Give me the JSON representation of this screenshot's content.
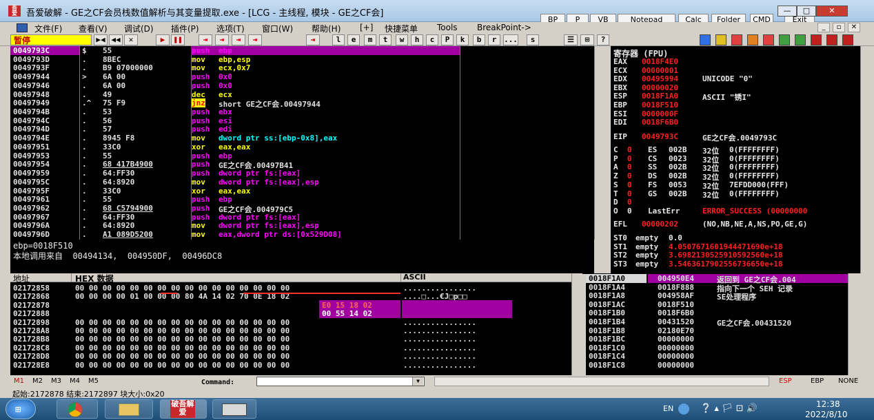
{
  "window": {
    "title": "吾爱破解 - GE之CF会员栈数值解析与其变量提取.exe - [LCG - 主线程, 模块 - GE之CF会]",
    "icon_text": "吾爱破解",
    "minimize": "—",
    "restore": "□",
    "close": "✕",
    "overlay_buttons": [
      "BP",
      "P",
      "VB",
      "Notepad",
      "Calc",
      "Folder",
      "CMD",
      "Exit"
    ]
  },
  "menu": {
    "items": [
      "文件(F)",
      "查看(V)",
      "调试(D)",
      "插件(P)",
      "选项(T)",
      "窗口(W)",
      "帮助(H)",
      "[+]",
      "快捷菜单",
      "Tools",
      "BreakPoint->"
    ],
    "mdi_controls": [
      "_",
      "▫",
      "✕"
    ]
  },
  "toolbar": {
    "status": "暂停",
    "nav_buttons": [
      "▶◀",
      "◀◀",
      "✕",
      "▶",
      "❚❚",
      "⇥",
      "⇥",
      "⇥",
      "⇥",
      "⇥",
      "l",
      "e",
      "m",
      "t",
      "w",
      "h",
      "c",
      "P",
      "k",
      "b",
      "r",
      "...",
      "s",
      "☰",
      "⊞",
      "?"
    ],
    "colors": [
      "#3070e0",
      "#e0c020",
      "#e04040",
      "#e08020",
      "#e04040",
      "#40a040",
      "#40a040",
      "#c02020",
      "#c02020",
      "#c02020"
    ]
  },
  "cpu": {
    "selected_addr": "0049793C",
    "rows": [
      {
        "addr": "0049793C",
        "flag": "$",
        "hex": "55",
        "op": "push",
        "arg": "ebp",
        "opc": "m",
        "argc": "m",
        "sel": true
      },
      {
        "addr": "0049793D",
        "flag": ".",
        "hex": "8BEC",
        "op": "mov",
        "arg": "ebp,esp",
        "opc": "y",
        "argc": "y"
      },
      {
        "addr": "0049793F",
        "flag": ".",
        "hex": "B9 07000000",
        "op": "mov",
        "arg": "ecx,0x7",
        "opc": "y",
        "argc": "y",
        "argnum": "0x7"
      },
      {
        "addr": "00497944",
        "flag": ">",
        "hex": "6A 00",
        "op": "push",
        "arg": "0x0",
        "opc": "m",
        "argc": "m"
      },
      {
        "addr": "00497946",
        "flag": ".",
        "hex": "6A 00",
        "op": "push",
        "arg": "0x0",
        "opc": "m",
        "argc": "m"
      },
      {
        "addr": "00497948",
        "flag": ".",
        "hex": "49",
        "op": "dec",
        "arg": "ecx",
        "opc": "y",
        "argc": "y"
      },
      {
        "addr": "00497949",
        "flag": ".^",
        "hex": "75 F9",
        "op": "jnz",
        "arg": "short GE之CF会.00497944",
        "opc": "jnz",
        "argc": "w"
      },
      {
        "addr": "0049794B",
        "flag": ".",
        "hex": "53",
        "op": "push",
        "arg": "ebx",
        "opc": "m",
        "argc": "m"
      },
      {
        "addr": "0049794C",
        "flag": ".",
        "hex": "56",
        "op": "push",
        "arg": "esi",
        "opc": "m",
        "argc": "m"
      },
      {
        "addr": "0049794D",
        "flag": ".",
        "hex": "57",
        "op": "push",
        "arg": "edi",
        "opc": "m",
        "argc": "m"
      },
      {
        "addr": "0049794E",
        "flag": ".",
        "hex": "8945 F8",
        "op": "mov",
        "arg": "dword ptr ss:[ebp-0x8],eax",
        "opc": "y",
        "argc": "c"
      },
      {
        "addr": "00497951",
        "flag": ".",
        "hex": "33C0",
        "op": "xor",
        "arg": "eax,eax",
        "opc": "y",
        "argc": "y"
      },
      {
        "addr": "00497953",
        "flag": ".",
        "hex": "55",
        "op": "push",
        "arg": "ebp",
        "opc": "m",
        "argc": "m"
      },
      {
        "addr": "00497954",
        "flag": ".",
        "hex": "68 417B4900",
        "op": "push",
        "arg": "GE之CF会.00497B41",
        "opc": "m",
        "argc": "w",
        "ul": true
      },
      {
        "addr": "00497959",
        "flag": ".",
        "hex": "64:FF30",
        "op": "push",
        "arg": "dword ptr fs:[eax]",
        "opc": "m",
        "argc": "m"
      },
      {
        "addr": "0049795C",
        "flag": ".",
        "hex": "64:8920",
        "op": "mov",
        "arg": "dword ptr fs:[eax],esp",
        "opc": "y",
        "argc": "m"
      },
      {
        "addr": "0049795F",
        "flag": ".",
        "hex": "33C0",
        "op": "xor",
        "arg": "eax,eax",
        "opc": "y",
        "argc": "y"
      },
      {
        "addr": "00497961",
        "flag": ".",
        "hex": "55",
        "op": "push",
        "arg": "ebp",
        "opc": "m",
        "argc": "m"
      },
      {
        "addr": "00497962",
        "flag": ".",
        "hex": "68 C5794900",
        "op": "push",
        "arg": "GE之CF会.004979C5",
        "opc": "m",
        "argc": "w",
        "ul": true
      },
      {
        "addr": "00497967",
        "flag": ".",
        "hex": "64:FF30",
        "op": "push",
        "arg": "dword ptr fs:[eax]",
        "opc": "m",
        "argc": "m"
      },
      {
        "addr": "0049796A",
        "flag": ".",
        "hex": "64:8920",
        "op": "mov",
        "arg": "dword ptr fs:[eax],esp",
        "opc": "y",
        "argc": "m"
      },
      {
        "addr": "0049796D",
        "flag": ".",
        "hex": "A1 089D5200",
        "op": "mov",
        "arg": "eax,dword ptr ds:[0x529D08]",
        "opc": "y",
        "argc": "m",
        "ul": true
      }
    ]
  },
  "info": {
    "line1": "ebp=0018F510",
    "line2": "本地调用来自  00494134,  004950DF,  00496DC8"
  },
  "registers": {
    "header": "寄存器 (FPU)",
    "gp": [
      {
        "name": "EAX",
        "val": "0018F4E0",
        "extra": ""
      },
      {
        "name": "ECX",
        "val": "00000001",
        "extra": ""
      },
      {
        "name": "EDX",
        "val": "00495994",
        "extra": "UNICODE \"0\""
      },
      {
        "name": "EBX",
        "val": "00000020",
        "extra": ""
      },
      {
        "name": "ESP",
        "val": "0018F1A0",
        "extra": "ASCII \"锈I\""
      },
      {
        "name": "EBP",
        "val": "0018F510",
        "extra": ""
      },
      {
        "name": "ESI",
        "val": "0000000F",
        "extra": ""
      },
      {
        "name": "EDI",
        "val": "0018F6B0",
        "extra": ""
      }
    ],
    "eip": {
      "name": "EIP",
      "val": "0049793C",
      "extra": "GE之CF会.0049793C"
    },
    "flags": [
      {
        "f": "C",
        "v": "0",
        "seg": "ES",
        "sv": "002B",
        "bits": "32位",
        "range": "0(FFFFFFFF)"
      },
      {
        "f": "P",
        "v": "0",
        "seg": "CS",
        "sv": "0023",
        "bits": "32位",
        "range": "0(FFFFFFFF)"
      },
      {
        "f": "A",
        "v": "0",
        "seg": "SS",
        "sv": "002B",
        "bits": "32位",
        "range": "0(FFFFFFFF)"
      },
      {
        "f": "Z",
        "v": "0",
        "seg": "DS",
        "sv": "002B",
        "bits": "32位",
        "range": "0(FFFFFFFF)"
      },
      {
        "f": "S",
        "v": "0",
        "seg": "FS",
        "sv": "0053",
        "bits": "32位",
        "range": "7EFDD000(FFF)"
      },
      {
        "f": "T",
        "v": "0",
        "seg": "GS",
        "sv": "002B",
        "bits": "32位",
        "range": "0(FFFFFFFF)"
      },
      {
        "f": "D",
        "v": "0",
        "seg": "",
        "sv": "",
        "bits": "",
        "range": ""
      }
    ],
    "lasterr": {
      "f": "O",
      "v": "0",
      "label": "LastErr",
      "val": "ERROR_SUCCESS (00000000"
    },
    "efl": {
      "name": "EFL",
      "val": "00000202",
      "extra": "(NO,NB,NE,A,NS,PO,GE,G)"
    },
    "fpu": [
      {
        "name": "ST0",
        "state": "empty",
        "val": "0.0",
        "red": false
      },
      {
        "name": "ST1",
        "state": "empty",
        "val": "4.0507671601944471690e+18",
        "red": true
      },
      {
        "name": "ST2",
        "state": "empty",
        "val": "3.6982130525910592560e+18",
        "red": true
      },
      {
        "name": "ST3",
        "state": "empty",
        "val": "3.5463617902556736650e+18",
        "red": true
      }
    ]
  },
  "dump": {
    "header_addr": "地址",
    "header_hex": "HEX 数据",
    "header_ascii": "ASCII",
    "rows": [
      {
        "addr": "02172858",
        "hex": "00 00 00 00 00 00 00 00 00 00 00 00 00 00 00 00",
        "ascii": "................"
      },
      {
        "addr": "02172868",
        "hex": "00 00 00 00 01 00 00 00 80 4A 14 02 70 0E 18 02",
        "ascii": "....□...€J□p□□"
      },
      {
        "addr": "02172878",
        "hex": "",
        "ascii": ""
      },
      {
        "addr": "02172888",
        "hex": "00 55 14 02",
        "ascii": ""
      },
      {
        "addr": "02172898",
        "hex": "00 00 00 00 00 00 00 00 00 00 00 00 00 00 00 00",
        "ascii": "................"
      },
      {
        "addr": "021728A8",
        "hex": "00 00 00 00 00 00 00 00 00 00 00 00 00 00 00 00",
        "ascii": "................"
      },
      {
        "addr": "021728B8",
        "hex": "00 00 00 00 00 00 00 00 00 00 00 00 00 00 00 00",
        "ascii": "................"
      },
      {
        "addr": "021728C8",
        "hex": "00 00 00 00 00 00 00 00 00 00 00 00 00 00 00 00",
        "ascii": "................"
      },
      {
        "addr": "021728D8",
        "hex": "00 00 00 00 00 00 00 00 00 00 00 00 00 00 00 00",
        "ascii": "................"
      },
      {
        "addr": "021728E8",
        "hex": "00 00 00 00 00 00 00 00 00 00 00 00 00 00 00 00",
        "ascii": "................"
      }
    ],
    "sel_hex_line2a": "E0 15 18 02",
    "sel_hex_line2b": "00 55 14 02"
  },
  "stack": {
    "rows": [
      {
        "addr": "0018F1A0",
        "val": "004950E4",
        "comment": "返回到 GE之CF会.004",
        "sel": true
      },
      {
        "addr": "0018F1A4",
        "val": "0018F888",
        "comment": "指向下一个 SEH 记录"
      },
      {
        "addr": "0018F1A8",
        "val": "004958AF",
        "comment": "SE处理程序"
      },
      {
        "addr": "0018F1AC",
        "val": "0018F510",
        "comment": ""
      },
      {
        "addr": "0018F1B0",
        "val": "0018F6B0",
        "comment": ""
      },
      {
        "addr": "0018F1B4",
        "val": "00431520",
        "comment": "GE之CF会.00431520"
      },
      {
        "addr": "0018F1B8",
        "val": "02180E70",
        "comment": ""
      },
      {
        "addr": "0018F1BC",
        "val": "00000000",
        "comment": ""
      },
      {
        "addr": "0018F1C0",
        "val": "00000000",
        "comment": ""
      },
      {
        "addr": "0018F1C4",
        "val": "00000000",
        "comment": ""
      },
      {
        "addr": "0018F1C8",
        "val": "00000000",
        "comment": ""
      }
    ]
  },
  "command": {
    "tabs": [
      "M1",
      "M2",
      "M3",
      "M4",
      "M5"
    ],
    "label": "Command:",
    "value": "",
    "right_tabs": [
      "ESP",
      "EBP",
      "NONE"
    ]
  },
  "status": {
    "text": "起始:2172878 结束:2172897 块大小:0x20"
  },
  "taskbar": {
    "lang": "EN",
    "time": "12:38",
    "date": "2022/8/10",
    "app_label": "破吾解爱"
  }
}
